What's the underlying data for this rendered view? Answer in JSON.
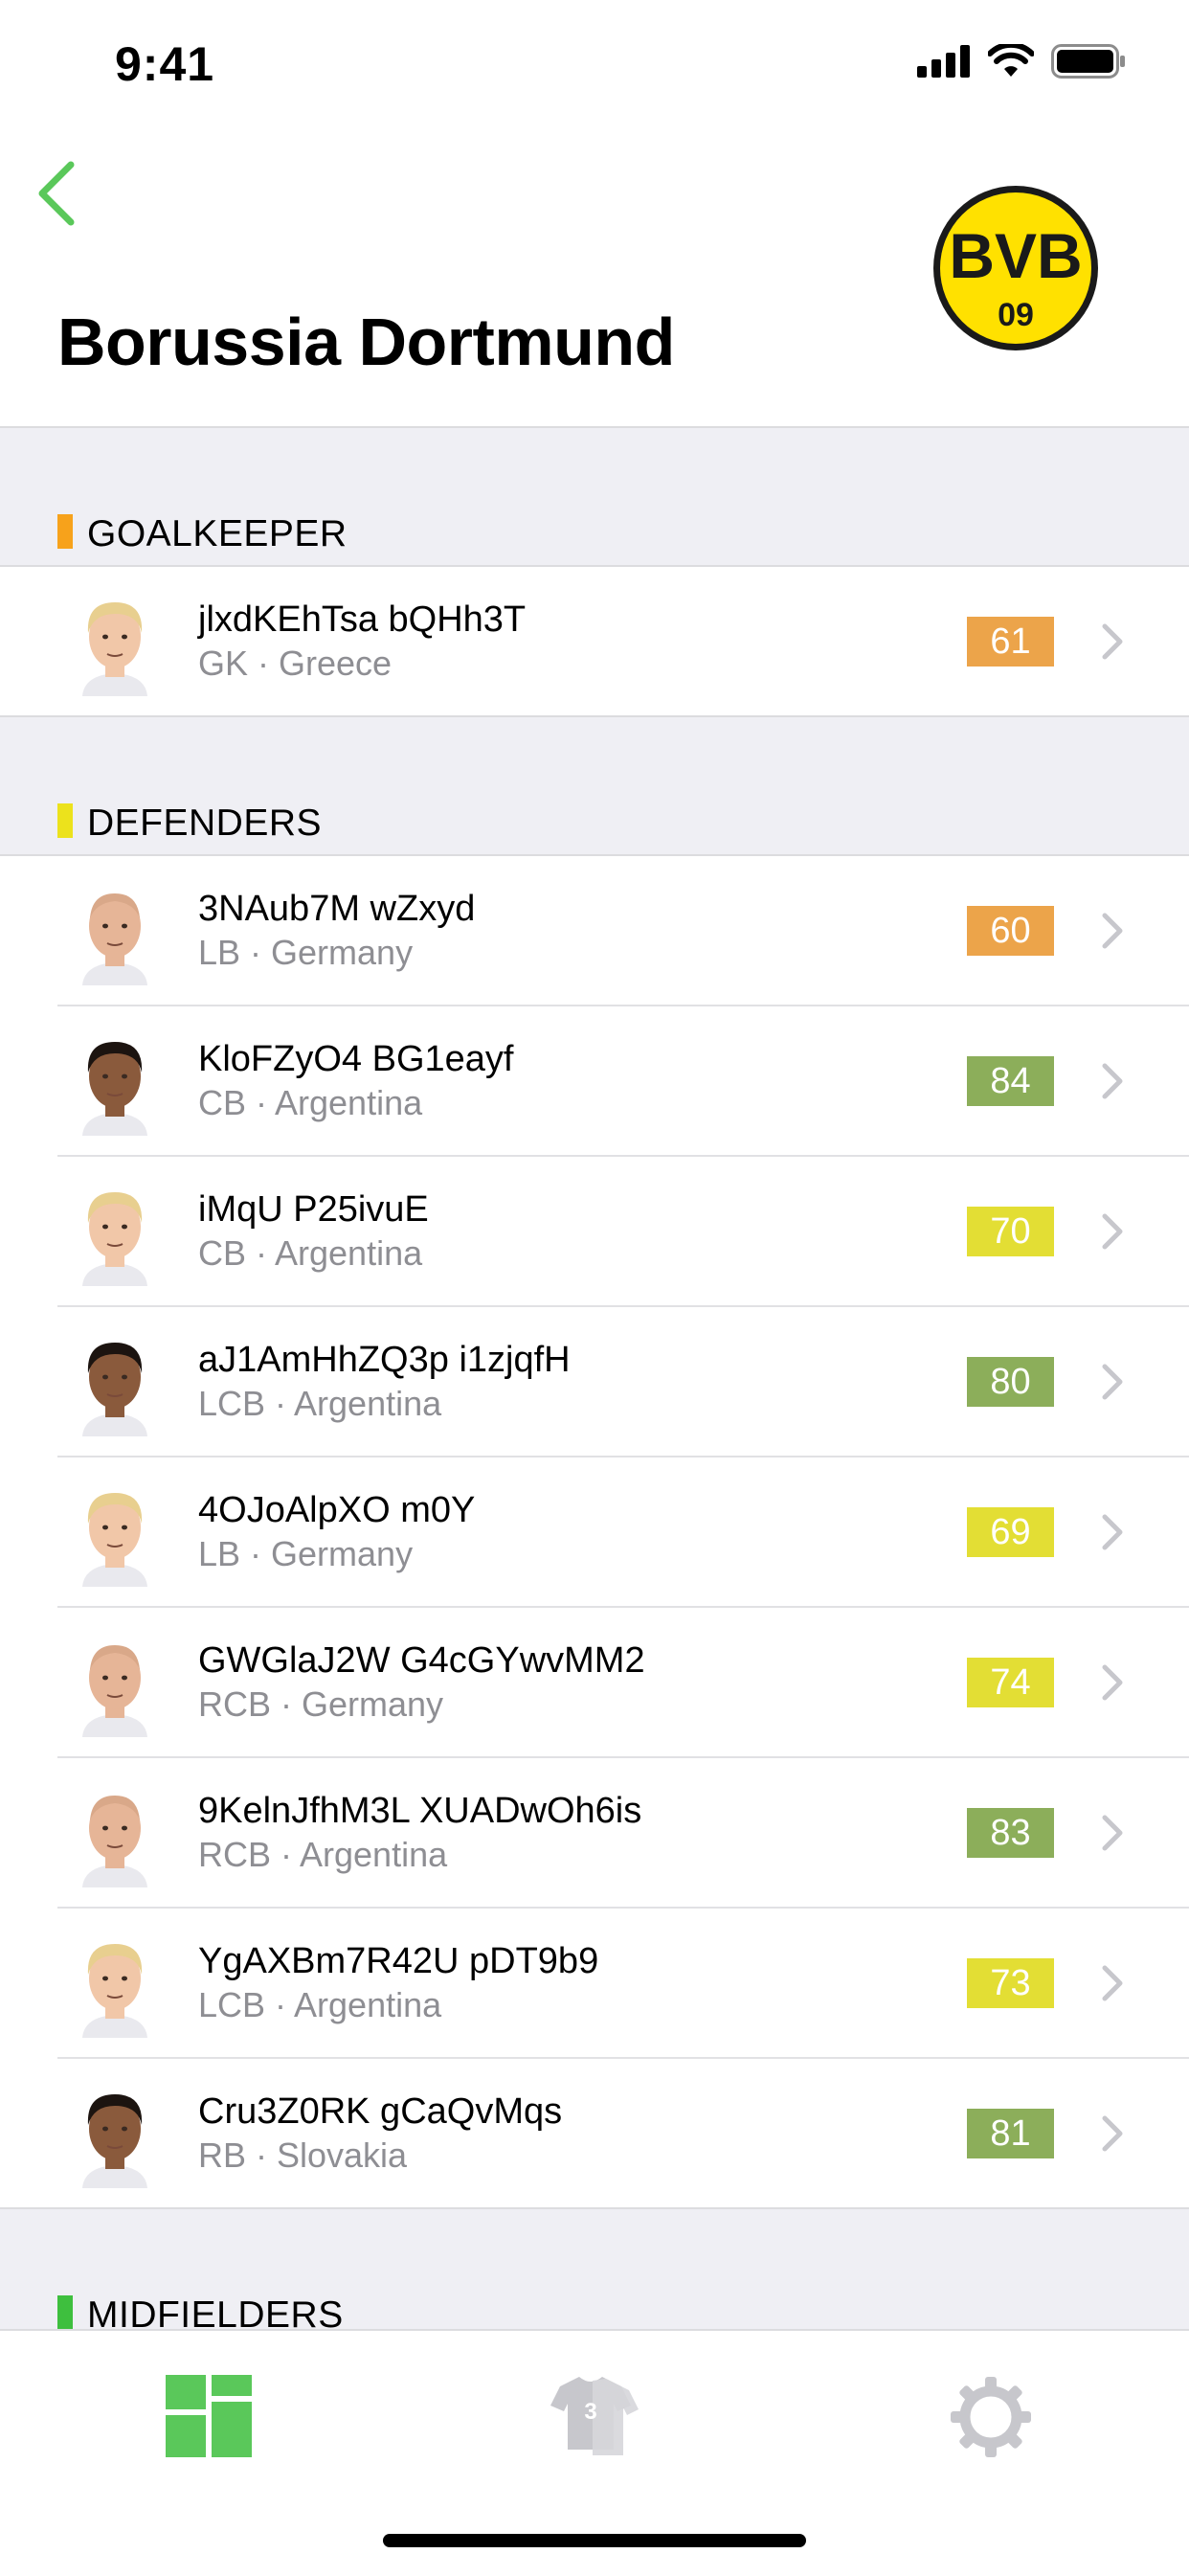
{
  "status_bar": {
    "time": "9:41"
  },
  "header": {
    "title": "Borussia Dortmund",
    "logo_text": "BVB",
    "logo_number": "09"
  },
  "colors": {
    "accent": "#5ac85a",
    "rating_orange": "#eca44a",
    "rating_green": "#8cae5a",
    "rating_yellow": "#e3de34",
    "goalkeeper_marker": "#f7a21b",
    "defenders_marker": "#ece21c",
    "midfielders_marker": "#3ebf3e"
  },
  "sections": [
    {
      "title": "GOALKEEPER",
      "marker_color": "#f7a21b",
      "players": [
        {
          "name": "jlxdKEhTsa bQHh3T",
          "detail": "GK · Greece",
          "rating": "61",
          "rating_color": "#eca44a",
          "avatar": "blond"
        }
      ]
    },
    {
      "title": "DEFENDERS",
      "marker_color": "#ece21c",
      "players": [
        {
          "name": "3NAub7M wZxyd",
          "detail": "LB · Germany",
          "rating": "60",
          "rating_color": "#eca44a",
          "avatar": "bald"
        },
        {
          "name": "KloFZyO4 BG1eayf",
          "detail": "CB · Argentina",
          "rating": "84",
          "rating_color": "#8cae5a",
          "avatar": "dark"
        },
        {
          "name": "iMqU P25ivuE",
          "detail": "CB · Argentina",
          "rating": "70",
          "rating_color": "#e3de34",
          "avatar": "blond"
        },
        {
          "name": "aJ1AmHhZQ3p i1zjqfH",
          "detail": "LCB · Argentina",
          "rating": "80",
          "rating_color": "#8cae5a",
          "avatar": "dark"
        },
        {
          "name": "4OJoAlpXO m0Y",
          "detail": "LB · Germany",
          "rating": "69",
          "rating_color": "#e3de34",
          "avatar": "blond"
        },
        {
          "name": "GWGlaJ2W G4cGYwvMM2",
          "detail": "RCB · Germany",
          "rating": "74",
          "rating_color": "#e3de34",
          "avatar": "bald"
        },
        {
          "name": "9KelnJfhM3L XUADwOh6is",
          "detail": "RCB · Argentina",
          "rating": "83",
          "rating_color": "#8cae5a",
          "avatar": "bald"
        },
        {
          "name": "YgAXBm7R42U pDT9b9",
          "detail": "LCB · Argentina",
          "rating": "73",
          "rating_color": "#e3de34",
          "avatar": "blond"
        },
        {
          "name": "Cru3Z0RK gCaQvMqs",
          "detail": "RB · Slovakia",
          "rating": "81",
          "rating_color": "#8cae5a",
          "avatar": "dark"
        }
      ]
    },
    {
      "title": "MIDFIELDERS",
      "marker_color": "#3ebf3e",
      "players": []
    }
  ],
  "tab_bar": {
    "tabs": [
      {
        "name": "tab-dashboard",
        "icon": "dashboard-icon",
        "active": true
      },
      {
        "name": "tab-squad",
        "icon": "jersey-icon",
        "active": false,
        "badge": "3"
      },
      {
        "name": "tab-settings",
        "icon": "gear-icon",
        "active": false
      }
    ]
  }
}
